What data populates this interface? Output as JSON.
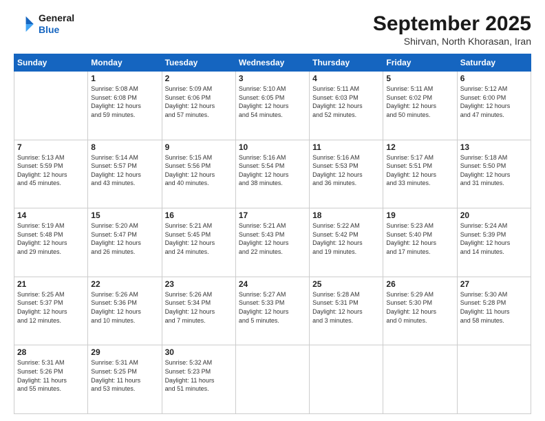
{
  "header": {
    "logo_line1": "General",
    "logo_line2": "Blue",
    "main_title": "September 2025",
    "sub_title": "Shirvan, North Khorasan, Iran"
  },
  "days_of_week": [
    "Sunday",
    "Monday",
    "Tuesday",
    "Wednesday",
    "Thursday",
    "Friday",
    "Saturday"
  ],
  "weeks": [
    [
      {
        "day": "",
        "info": ""
      },
      {
        "day": "1",
        "info": "Sunrise: 5:08 AM\nSunset: 6:08 PM\nDaylight: 12 hours\nand 59 minutes."
      },
      {
        "day": "2",
        "info": "Sunrise: 5:09 AM\nSunset: 6:06 PM\nDaylight: 12 hours\nand 57 minutes."
      },
      {
        "day": "3",
        "info": "Sunrise: 5:10 AM\nSunset: 6:05 PM\nDaylight: 12 hours\nand 54 minutes."
      },
      {
        "day": "4",
        "info": "Sunrise: 5:11 AM\nSunset: 6:03 PM\nDaylight: 12 hours\nand 52 minutes."
      },
      {
        "day": "5",
        "info": "Sunrise: 5:11 AM\nSunset: 6:02 PM\nDaylight: 12 hours\nand 50 minutes."
      },
      {
        "day": "6",
        "info": "Sunrise: 5:12 AM\nSunset: 6:00 PM\nDaylight: 12 hours\nand 47 minutes."
      }
    ],
    [
      {
        "day": "7",
        "info": "Sunrise: 5:13 AM\nSunset: 5:59 PM\nDaylight: 12 hours\nand 45 minutes."
      },
      {
        "day": "8",
        "info": "Sunrise: 5:14 AM\nSunset: 5:57 PM\nDaylight: 12 hours\nand 43 minutes."
      },
      {
        "day": "9",
        "info": "Sunrise: 5:15 AM\nSunset: 5:56 PM\nDaylight: 12 hours\nand 40 minutes."
      },
      {
        "day": "10",
        "info": "Sunrise: 5:16 AM\nSunset: 5:54 PM\nDaylight: 12 hours\nand 38 minutes."
      },
      {
        "day": "11",
        "info": "Sunrise: 5:16 AM\nSunset: 5:53 PM\nDaylight: 12 hours\nand 36 minutes."
      },
      {
        "day": "12",
        "info": "Sunrise: 5:17 AM\nSunset: 5:51 PM\nDaylight: 12 hours\nand 33 minutes."
      },
      {
        "day": "13",
        "info": "Sunrise: 5:18 AM\nSunset: 5:50 PM\nDaylight: 12 hours\nand 31 minutes."
      }
    ],
    [
      {
        "day": "14",
        "info": "Sunrise: 5:19 AM\nSunset: 5:48 PM\nDaylight: 12 hours\nand 29 minutes."
      },
      {
        "day": "15",
        "info": "Sunrise: 5:20 AM\nSunset: 5:47 PM\nDaylight: 12 hours\nand 26 minutes."
      },
      {
        "day": "16",
        "info": "Sunrise: 5:21 AM\nSunset: 5:45 PM\nDaylight: 12 hours\nand 24 minutes."
      },
      {
        "day": "17",
        "info": "Sunrise: 5:21 AM\nSunset: 5:43 PM\nDaylight: 12 hours\nand 22 minutes."
      },
      {
        "day": "18",
        "info": "Sunrise: 5:22 AM\nSunset: 5:42 PM\nDaylight: 12 hours\nand 19 minutes."
      },
      {
        "day": "19",
        "info": "Sunrise: 5:23 AM\nSunset: 5:40 PM\nDaylight: 12 hours\nand 17 minutes."
      },
      {
        "day": "20",
        "info": "Sunrise: 5:24 AM\nSunset: 5:39 PM\nDaylight: 12 hours\nand 14 minutes."
      }
    ],
    [
      {
        "day": "21",
        "info": "Sunrise: 5:25 AM\nSunset: 5:37 PM\nDaylight: 12 hours\nand 12 minutes."
      },
      {
        "day": "22",
        "info": "Sunrise: 5:26 AM\nSunset: 5:36 PM\nDaylight: 12 hours\nand 10 minutes."
      },
      {
        "day": "23",
        "info": "Sunrise: 5:26 AM\nSunset: 5:34 PM\nDaylight: 12 hours\nand 7 minutes."
      },
      {
        "day": "24",
        "info": "Sunrise: 5:27 AM\nSunset: 5:33 PM\nDaylight: 12 hours\nand 5 minutes."
      },
      {
        "day": "25",
        "info": "Sunrise: 5:28 AM\nSunset: 5:31 PM\nDaylight: 12 hours\nand 3 minutes."
      },
      {
        "day": "26",
        "info": "Sunrise: 5:29 AM\nSunset: 5:30 PM\nDaylight: 12 hours\nand 0 minutes."
      },
      {
        "day": "27",
        "info": "Sunrise: 5:30 AM\nSunset: 5:28 PM\nDaylight: 11 hours\nand 58 minutes."
      }
    ],
    [
      {
        "day": "28",
        "info": "Sunrise: 5:31 AM\nSunset: 5:26 PM\nDaylight: 11 hours\nand 55 minutes."
      },
      {
        "day": "29",
        "info": "Sunrise: 5:31 AM\nSunset: 5:25 PM\nDaylight: 11 hours\nand 53 minutes."
      },
      {
        "day": "30",
        "info": "Sunrise: 5:32 AM\nSunset: 5:23 PM\nDaylight: 11 hours\nand 51 minutes."
      },
      {
        "day": "",
        "info": ""
      },
      {
        "day": "",
        "info": ""
      },
      {
        "day": "",
        "info": ""
      },
      {
        "day": "",
        "info": ""
      }
    ]
  ]
}
